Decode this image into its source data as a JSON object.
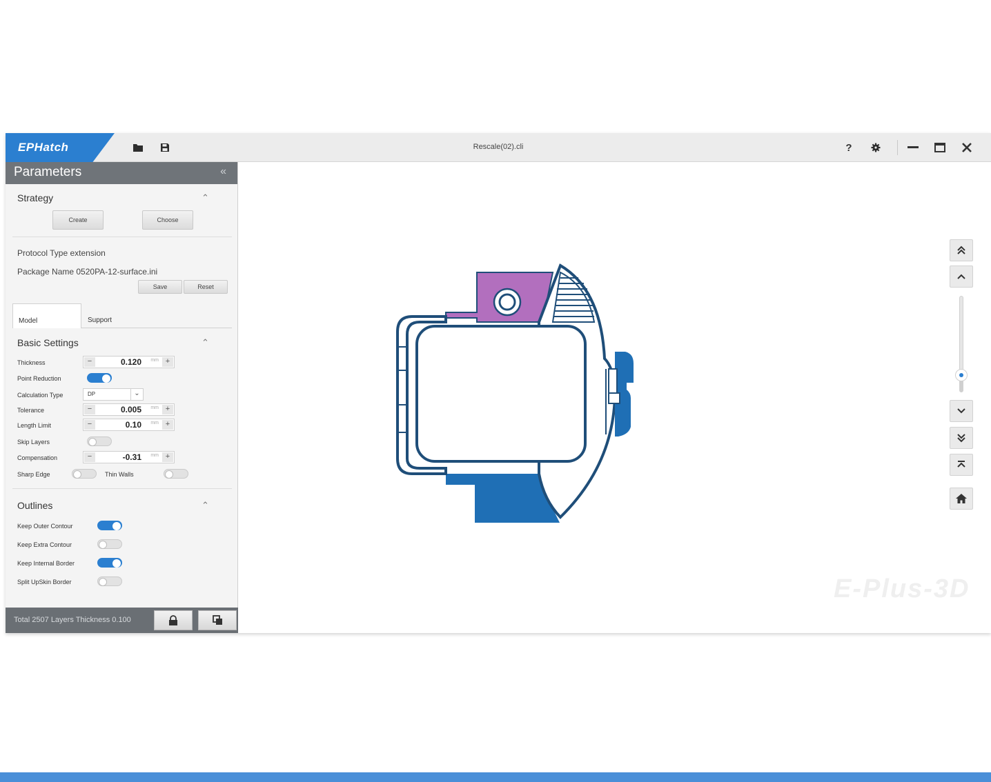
{
  "app": {
    "brand": "EPHatch",
    "window_title": "Rescale(02).cli",
    "watermark": "E-Plus-3D",
    "accent_color": "#2b7fd0"
  },
  "toolbar": {
    "open_icon": "folder-icon",
    "save_icon": "save-icon"
  },
  "window_controls": {
    "help": "?",
    "settings_icon": "gear-icon",
    "minimize": "–",
    "maximize": "☐",
    "close": "✕"
  },
  "panel": {
    "title": "Parameters",
    "strategy": {
      "title": "Strategy",
      "create_label": "Create",
      "choose_label": "Choose"
    },
    "protocol": {
      "type_line": "Protocol Type   extension",
      "package_line": "Package Name 0520PA-12-surface.ini",
      "save_label": "Save",
      "reset_label": "Reset"
    },
    "tabs": [
      {
        "label": "Model",
        "active": true
      },
      {
        "label": "Support",
        "active": false
      }
    ],
    "basic": {
      "title": "Basic Settings",
      "thickness_label": "Thickness",
      "thickness_value": "0.120",
      "unit": "mm",
      "point_reduction_label": "Point Reduction",
      "point_reduction_on": true,
      "calc_type_label": "Calculation Type",
      "calc_type_value": "DP",
      "tolerance_label": "Tolerance",
      "tolerance_value": "0.005",
      "length_limit_label": "Length Limit",
      "length_limit_value": "0.10",
      "skip_layers_label": "Skip Layers",
      "skip_layers_on": false,
      "compensation_label": "Compensation",
      "compensation_value": "-0.31",
      "sharp_edge_label": "Sharp Edge",
      "sharp_edge_on": false,
      "thin_walls_label": "Thin Walls",
      "thin_walls_on": false
    },
    "outlines": {
      "title": "Outlines",
      "keep_outer_label": "Keep Outer Contour",
      "keep_outer_on": true,
      "keep_extra_label": "Keep Extra Contour",
      "keep_extra_on": false,
      "keep_internal_label": "Keep Internal Border",
      "keep_internal_on": true,
      "split_label": "Split UpSkin Border",
      "split_on": false
    },
    "status": {
      "text": "Total 2507 Layers Thickness 0.100"
    }
  },
  "viewport": {
    "slider_level": 0.18,
    "model_colors": {
      "outline": "#1f4e79",
      "fill_blue": "#1f6fb5",
      "fill_purple": "#b26fbe"
    }
  }
}
